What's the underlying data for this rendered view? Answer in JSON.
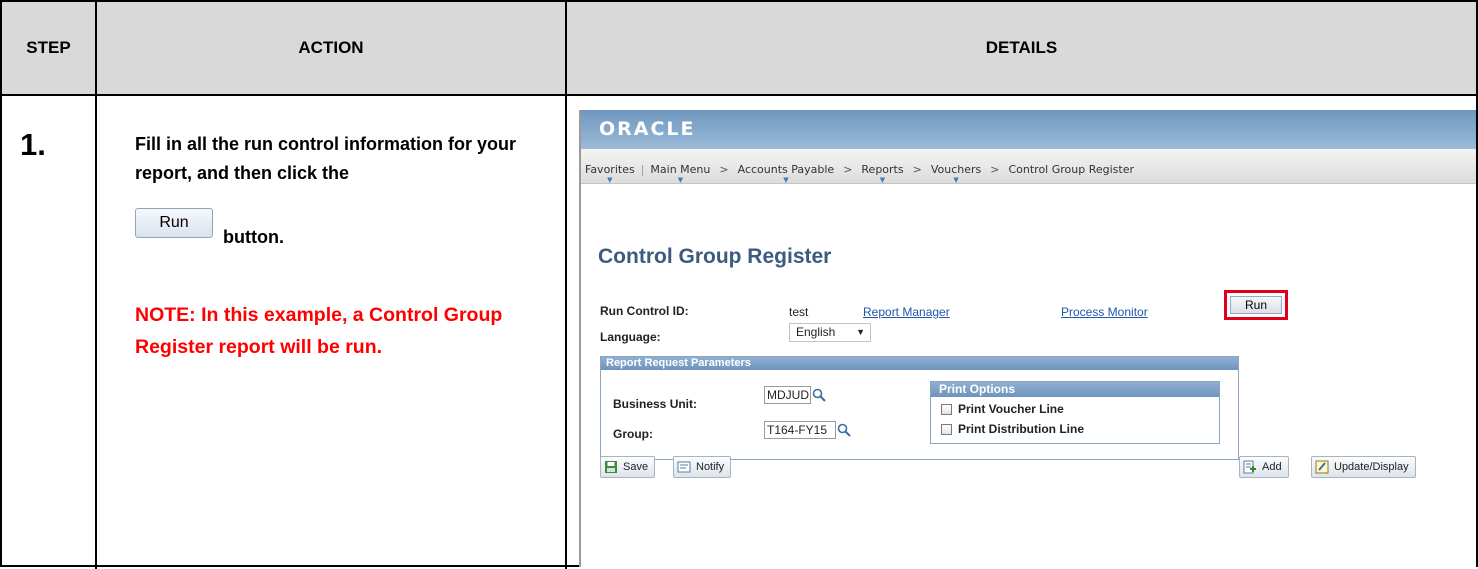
{
  "table": {
    "headers": {
      "step": "STEP",
      "action": "ACTION",
      "details": "DETAILS"
    }
  },
  "step": {
    "number": "1.",
    "instruction": "Fill in all the run control information for your report, and then click the",
    "button_label": "Run",
    "button_suffix": "button.",
    "note": "NOTE:  In this example, a Control Group Register report will be run."
  },
  "screenshot": {
    "brand": "ORACLE",
    "nav": {
      "items": [
        "Favorites",
        "Main Menu",
        "Accounts Payable",
        "Reports",
        "Vouchers",
        "Control Group Register"
      ],
      "separator": ">"
    },
    "page_title": "Control Group Register",
    "run_control": {
      "label": "Run Control ID:",
      "value": "test",
      "report_manager_link": "Report Manager",
      "process_monitor_link": "Process Monitor",
      "run_button": "Run"
    },
    "language": {
      "label": "Language:",
      "value": "English"
    },
    "report_params": {
      "title": "Report Request Parameters",
      "business_unit": {
        "label": "Business Unit:",
        "value": "MDJUD"
      },
      "group": {
        "label": "Group:",
        "value": "T164-FY15"
      }
    },
    "print_options": {
      "title": "Print Options",
      "voucher_line": {
        "label": "Print Voucher Line",
        "checked": false
      },
      "distribution_line": {
        "label": "Print Distribution Line",
        "checked": false
      }
    },
    "toolbar": {
      "save": "Save",
      "notify": "Notify",
      "add": "Add",
      "update_display": "Update/Display"
    }
  },
  "colors": {
    "header_bg": "#d9d9d9",
    "note_red": "#ff0000",
    "title_blue": "#3d5a80",
    "link_blue": "#2255aa",
    "highlight_red": "#e0001a"
  }
}
